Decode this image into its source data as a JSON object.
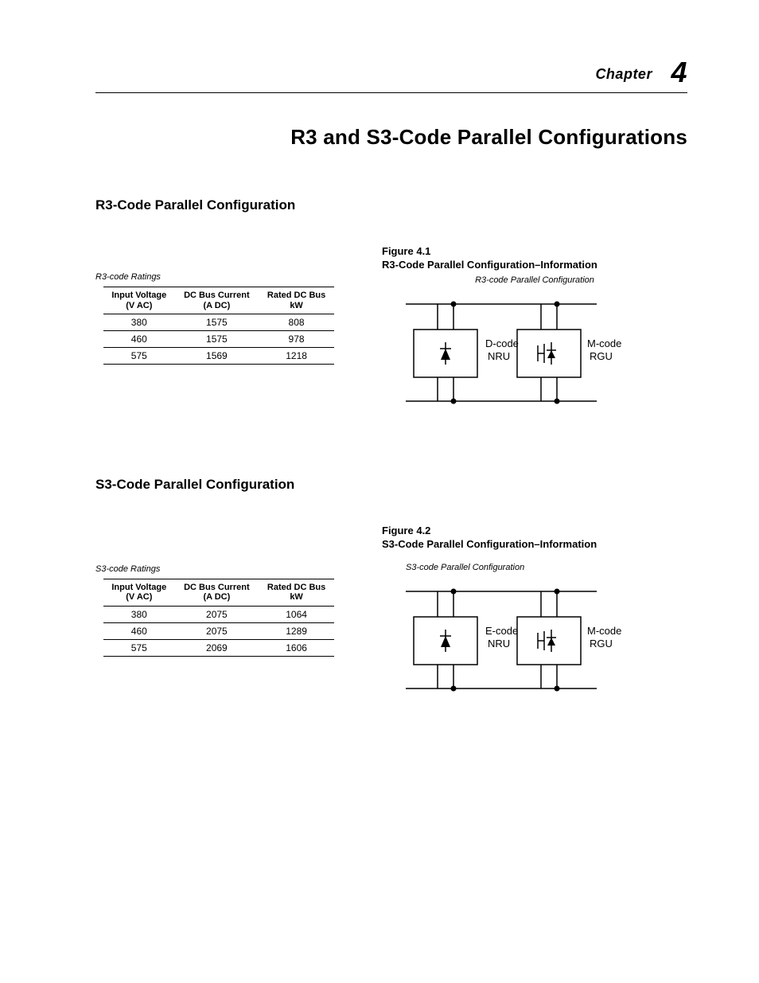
{
  "chapter": {
    "label": "Chapter",
    "number": "4"
  },
  "title": "R3 and S3-Code Parallel Configurations",
  "sections": [
    {
      "heading": "R3-Code Parallel Configuration",
      "tableCaption": "R3-code Ratings",
      "figNumber": "Figure 4.1",
      "figTitle": "R3-Code Parallel Configuration–Information",
      "figSub": "R3-code Parallel Configuration",
      "cols": [
        {
          "l1": "Input Voltage",
          "l2": "(V AC)"
        },
        {
          "l1": "DC Bus Current",
          "l2": "(A DC)"
        },
        {
          "l1": "Rated DC Bus",
          "l2": "kW"
        }
      ],
      "rows": [
        {
          "c0": "380",
          "c1": "1575",
          "c2": "808"
        },
        {
          "c0": "460",
          "c1": "1575",
          "c2": "978"
        },
        {
          "c0": "575",
          "c1": "1569",
          "c2": "1218"
        }
      ],
      "diagram": {
        "leftL1": "D-code",
        "leftL2": "NRU",
        "rightL1": "M-code",
        "rightL2": "RGU"
      }
    },
    {
      "heading": "S3-Code Parallel Configuration",
      "tableCaption": "S3-code Ratings",
      "figNumber": "Figure 4.2",
      "figTitle": "S3-Code Parallel Configuration–Information",
      "figSub": "S3-code Parallel Configuration",
      "cols": [
        {
          "l1": "Input Voltage",
          "l2": "(V AC)"
        },
        {
          "l1": "DC Bus Current",
          "l2": "(A DC)"
        },
        {
          "l1": "Rated DC Bus",
          "l2": "kW"
        }
      ],
      "rows": [
        {
          "c0": "380",
          "c1": "2075",
          "c2": "1064"
        },
        {
          "c0": "460",
          "c1": "2075",
          "c2": "1289"
        },
        {
          "c0": "575",
          "c1": "2069",
          "c2": "1606"
        }
      ],
      "diagram": {
        "leftL1": "E-code",
        "leftL2": "NRU",
        "rightL1": "M-code",
        "rightL2": "RGU"
      }
    }
  ]
}
